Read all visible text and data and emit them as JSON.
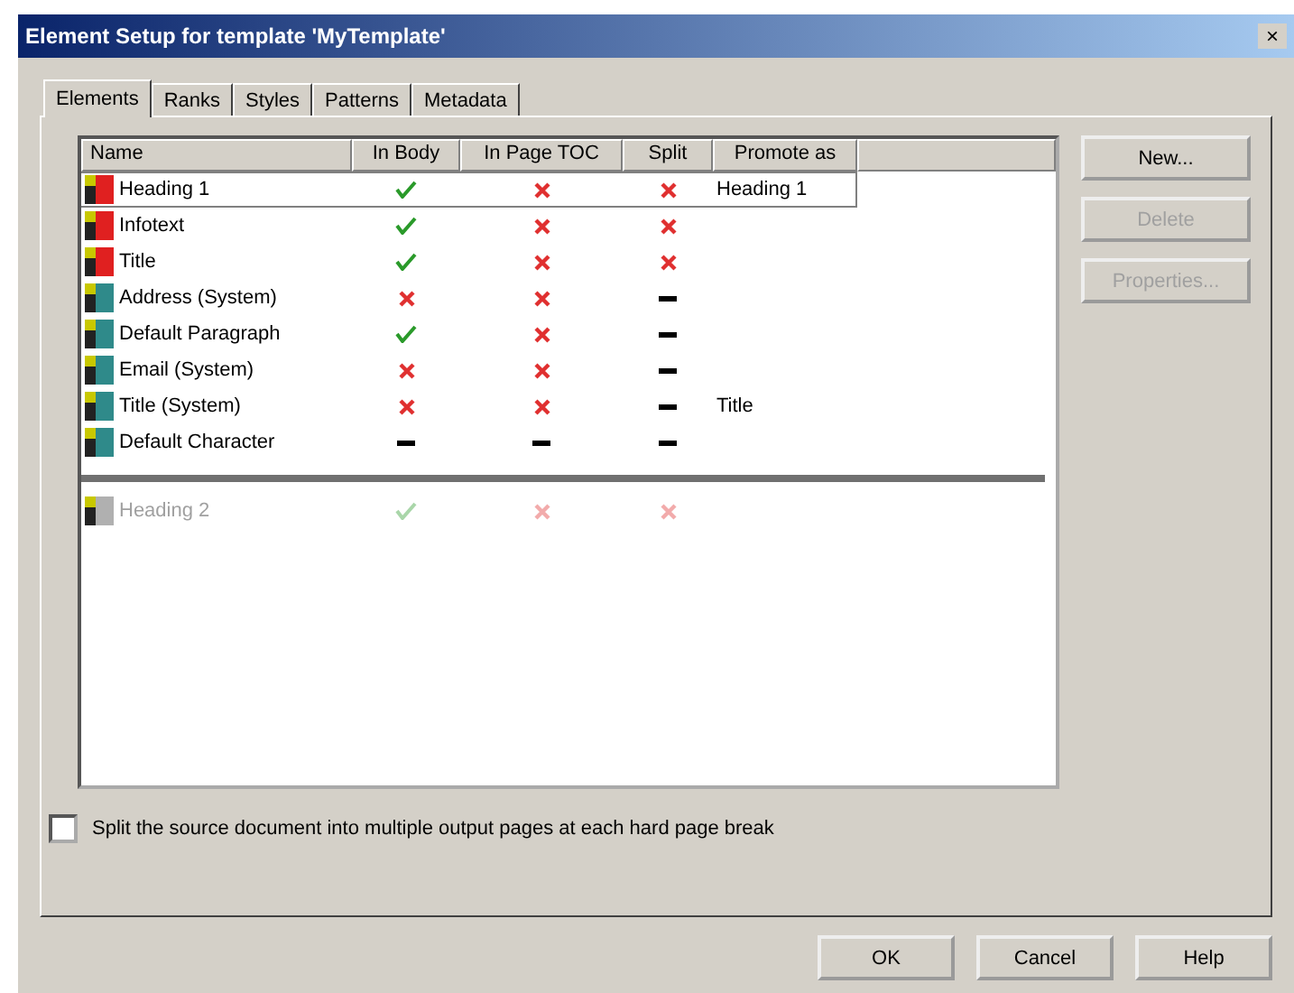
{
  "window": {
    "title": "Element Setup for template 'MyTemplate'",
    "close": "×"
  },
  "tabs": [
    {
      "label": "Elements",
      "selected": true
    },
    {
      "label": "Ranks",
      "selected": false
    },
    {
      "label": "Styles",
      "selected": false
    },
    {
      "label": "Patterns",
      "selected": false
    },
    {
      "label": "Metadata",
      "selected": false
    }
  ],
  "table": {
    "columns": [
      "Name",
      "In Body",
      "In Page TOC",
      "Split",
      "Promote as"
    ],
    "rows": [
      {
        "name": "Heading 1",
        "color": "#e02020",
        "marks": [
          {
            "kind": "check"
          },
          {
            "kind": "cross"
          },
          {
            "kind": "cross"
          }
        ],
        "promote_as": "Heading 1",
        "selected": true,
        "disabled": false
      },
      {
        "name": "Infotext",
        "color": "#e02020",
        "marks": [
          {
            "kind": "check"
          },
          {
            "kind": "cross"
          },
          {
            "kind": "cross"
          }
        ],
        "selected": false,
        "disabled": false
      },
      {
        "name": "Title",
        "color": "#e02020",
        "marks": [
          {
            "kind": "check"
          },
          {
            "kind": "cross"
          },
          {
            "kind": "cross"
          }
        ],
        "selected": false,
        "disabled": false
      },
      {
        "name": "Address (System)",
        "color": "#2f8a8a",
        "marks": [
          {
            "kind": "cross"
          },
          {
            "kind": "cross"
          },
          {
            "kind": "dash"
          }
        ],
        "selected": false,
        "disabled": false
      },
      {
        "name": "Default Paragraph",
        "color": "#2f8a8a",
        "marks": [
          {
            "kind": "check"
          },
          {
            "kind": "cross"
          },
          {
            "kind": "dash"
          }
        ],
        "selected": false,
        "disabled": false
      },
      {
        "name": "Email (System)",
        "color": "#2f8a8a",
        "marks": [
          {
            "kind": "cross"
          },
          {
            "kind": "cross"
          },
          {
            "kind": "dash"
          }
        ],
        "selected": false,
        "disabled": false
      },
      {
        "name": "Title (System)",
        "color": "#2f8a8a",
        "marks": [
          {
            "kind": "cross"
          },
          {
            "kind": "cross"
          },
          {
            "kind": "dash"
          }
        ],
        "promote_as": "Title",
        "selected": false,
        "disabled": false
      },
      {
        "name": "Default Character",
        "color": "#2f8a8a",
        "marks": [
          {
            "kind": "dash"
          },
          {
            "kind": "dash"
          },
          {
            "kind": "dash"
          }
        ],
        "selected": false,
        "disabled": false
      }
    ],
    "unused_rows": [
      {
        "name": "Heading 2",
        "color": "#b0b0b0",
        "marks": [
          {
            "kind": "check"
          },
          {
            "kind": "cross"
          },
          {
            "kind": "cross"
          }
        ],
        "selected": false,
        "disabled": true
      }
    ]
  },
  "side_buttons": [
    {
      "label": "New...",
      "disabled": false
    },
    {
      "label": "Delete",
      "disabled": true
    },
    {
      "label": "Properties...",
      "disabled": true
    }
  ],
  "split_option": {
    "label": "Split the source document into multiple output pages at each hard page break",
    "checked": false
  },
  "buttons": [
    "OK",
    "Cancel",
    "Help"
  ]
}
